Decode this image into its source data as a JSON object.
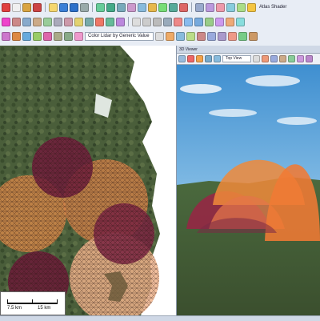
{
  "toolbar": {
    "shader_label": "Atlas Shader",
    "color_combo": "Color Lidar by Generic Value",
    "icons": [
      "new-icon",
      "open-icon",
      "save-icon",
      "close-icon",
      "import-icon",
      "info-icon",
      "help-icon",
      "globe-icon",
      "layers-icon",
      "grid-icon",
      "chart-icon",
      "ruler-icon",
      "terrain-icon",
      "palette-icon",
      "settings-icon",
      "measure-icon",
      "polygon-icon",
      "line-icon",
      "point-icon",
      "select-icon",
      "zoom-in-icon",
      "zoom-out-icon",
      "pan-icon",
      "home-icon"
    ]
  },
  "map": {
    "scale_labels": [
      "7.5 km",
      "15 km"
    ]
  },
  "viewer": {
    "title": "3D Viewer",
    "view_combo": "Top View"
  }
}
